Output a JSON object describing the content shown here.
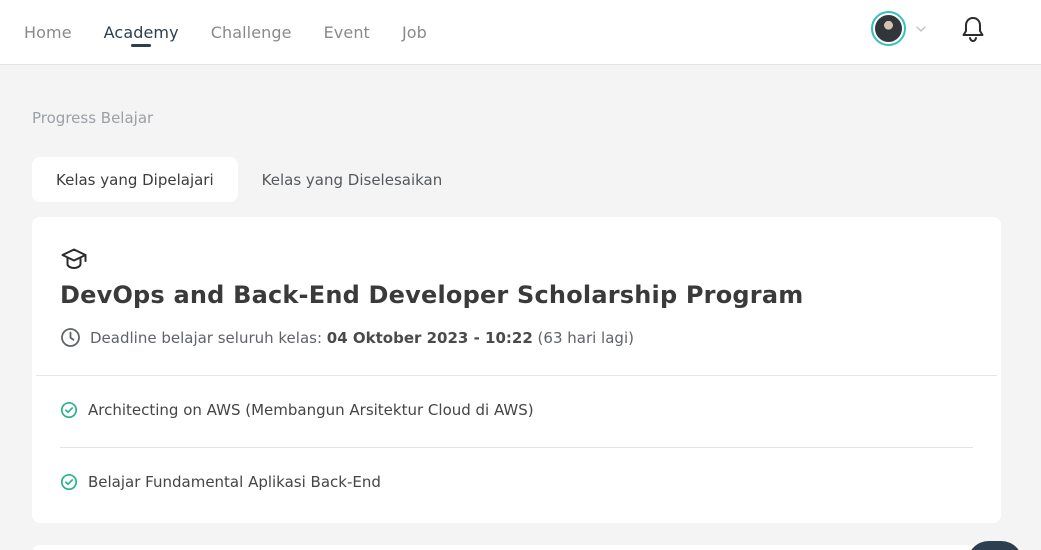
{
  "nav": {
    "items": [
      {
        "label": "Home",
        "active": false
      },
      {
        "label": "Academy",
        "active": true
      },
      {
        "label": "Challenge",
        "active": false
      },
      {
        "label": "Event",
        "active": false
      },
      {
        "label": "Job",
        "active": false
      }
    ]
  },
  "header": {
    "avatar_icon": "user-avatar",
    "dropdown_icon": "chevron-down-icon",
    "notification_icon": "bell-icon"
  },
  "page": {
    "section_label": "Progress Belajar",
    "tabs": [
      {
        "label": "Kelas yang Dipelajari",
        "active": true
      },
      {
        "label": "Kelas yang Diselesaikan",
        "active": false
      }
    ]
  },
  "card": {
    "icon": "graduation-cap-icon",
    "title": "DevOps and Back-End Developer Scholarship Program",
    "deadline_prefix": "Deadline belajar seluruh kelas: ",
    "deadline_date": "04 Oktober 2023 - 10:22",
    "deadline_remaining": " (63 hari lagi)",
    "modules": [
      {
        "label": "Architecting on AWS (Membangun Arsitektur Cloud di AWS)",
        "status": "completed"
      },
      {
        "label": "Belajar Fundamental Aplikasi Back-End",
        "status": "completed"
      }
    ]
  },
  "colors": {
    "accent": "#2d3e50",
    "check": "#2bb38a",
    "avatar_ring": "#35bfbf",
    "background": "#f4f4f4"
  }
}
